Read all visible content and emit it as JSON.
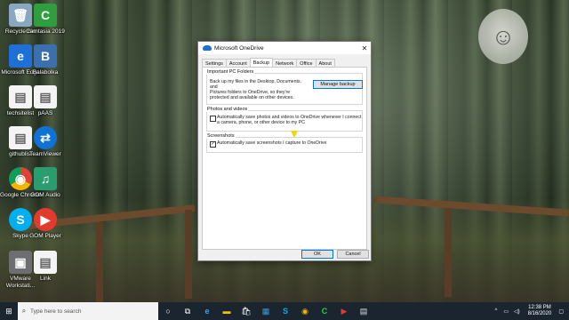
{
  "desktop": {
    "icons": [
      {
        "label": "Recycle Bin",
        "glyph": "🗑"
      },
      {
        "label": "Camtasia 2019",
        "glyph": "C"
      },
      {
        "label": "Microsoft Edge",
        "glyph": "e"
      },
      {
        "label": "Balabolka",
        "glyph": "B"
      },
      {
        "label": "techsitelist",
        "glyph": "▤"
      },
      {
        "label": "pAAS",
        "glyph": "▤"
      },
      {
        "label": "githublist",
        "glyph": "▤"
      },
      {
        "label": "TeamViewer",
        "glyph": "⇄"
      },
      {
        "label": "Google Chrome",
        "glyph": "◉"
      },
      {
        "label": "GOM Audio",
        "glyph": "♫"
      },
      {
        "label": "Skype",
        "glyph": "S"
      },
      {
        "label": "GOM Player",
        "glyph": "▶"
      },
      {
        "label": "VMware Workstati...",
        "glyph": "▣"
      },
      {
        "label": "Link",
        "glyph": "▤"
      }
    ]
  },
  "dialog": {
    "title": "Microsoft OneDrive",
    "close_glyph": "✕",
    "tabs": [
      "Settings",
      "Account",
      "Backup",
      "Network",
      "Office",
      "About"
    ],
    "important": {
      "label": "Important PC Folders",
      "text_1": "Back up my files in the Desktop, Documents, and",
      "text_2": "Pictures folders to OneDrive, so they're",
      "text_3": "protected and available on other devices.",
      "button": "Manage backup"
    },
    "photos": {
      "label": "Photos and videos",
      "text_1": "Automatically save photos and videos to OneDrive whenever I connect",
      "text_2": "a camera, phone, or other device to my PC",
      "checked": false
    },
    "screenshots": {
      "label": "Screenshots",
      "text": "Automatically save screenshots I capture to OneDrive",
      "checked": true,
      "check_glyph": "✓"
    },
    "ok": "OK",
    "cancel": "Cancel"
  },
  "taskbar": {
    "start_glyph": "⊞",
    "search_placeholder": "Type here to search",
    "apps": [
      "○",
      "⧉",
      "e",
      "▬",
      "🛍",
      "▦",
      "S",
      "◉",
      "C",
      "▶",
      "▤"
    ],
    "tray_chevron": "^",
    "time": "12:38 PM",
    "date": "8/16/2020"
  }
}
